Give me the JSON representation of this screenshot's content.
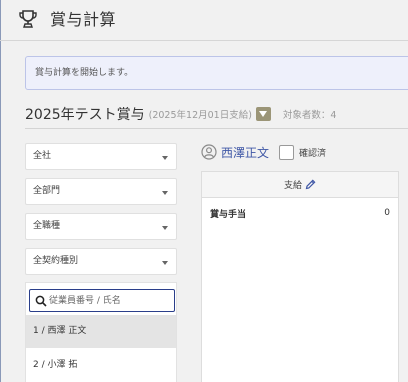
{
  "page": {
    "title": "賞与計算"
  },
  "notice": {
    "text": "賞与計算を開始します。"
  },
  "bonus": {
    "title": "2025年テスト賞与",
    "date": "(2025年12月01日支給)",
    "count_label": "対象者数：4"
  },
  "filters": [
    {
      "value": "全社"
    },
    {
      "value": "全部門"
    },
    {
      "value": "全職種"
    },
    {
      "value": "全契約種別"
    }
  ],
  "search": {
    "placeholder": "従業員番号 / 氏名",
    "value": ""
  },
  "employees": [
    {
      "label": "1 / 西澤 正文",
      "selected": true
    },
    {
      "label": "2 / 小澤 拓",
      "selected": false
    }
  ],
  "detail": {
    "person_name": "西澤正文",
    "confirm_label": "確認済",
    "confirmed": false,
    "section_header": "支給",
    "items": [
      {
        "label": "賞与手当",
        "value": "0"
      }
    ]
  },
  "colors": {
    "accent": "#3f57a6",
    "toggle": "#9b9577",
    "search_border": "#2a3e8a"
  },
  "icons": [
    "trophy-icon",
    "chevron-down-icon",
    "search-icon",
    "person-icon",
    "pencil-icon"
  ]
}
